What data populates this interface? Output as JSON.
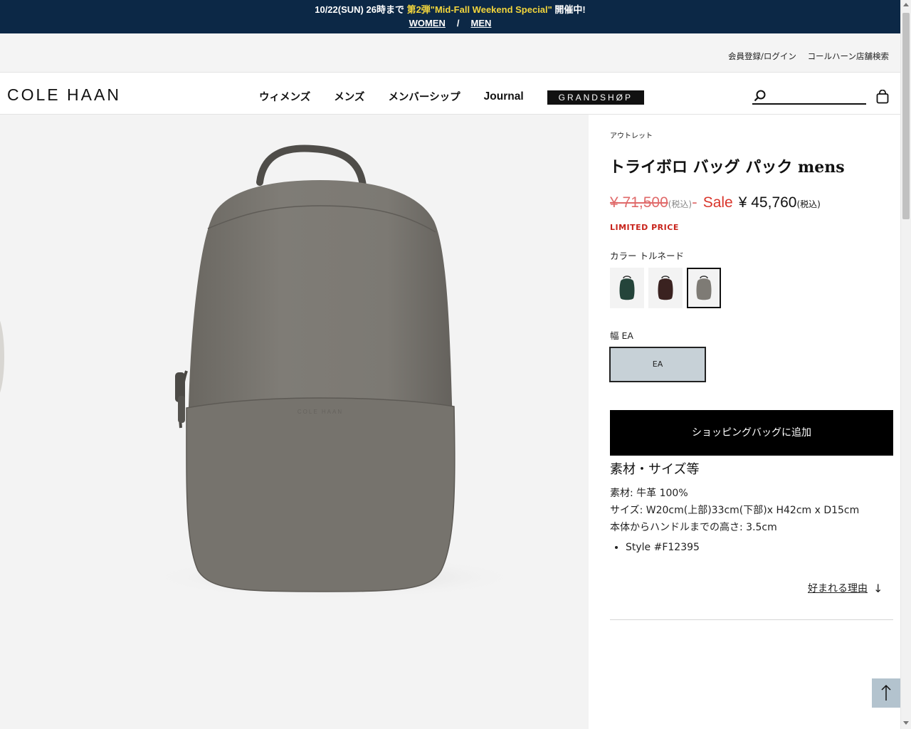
{
  "promo": {
    "prefix": "10/22(SUN) 26時まで ",
    "highlight": "第2弾\"Mid-Fall Weekend Special\"",
    "suffix": " 開催中!",
    "links": [
      "WOMEN",
      "MEN"
    ],
    "separator": "/"
  },
  "utility": {
    "register": "会員登録/ログイン",
    "store_search": "コールハーン店舗検索"
  },
  "header": {
    "logo": "COLE HAAN",
    "nav": [
      "ウィメンズ",
      "メンズ",
      "メンバーシップ",
      "Journal"
    ],
    "grandshop": "GRANDSHØP",
    "search_placeholder": ""
  },
  "product": {
    "breadcrumb": "アウトレット",
    "title": "トライボロ バッグ パック mens",
    "original_price": "¥ 71,500",
    "tax_note": "(税込)",
    "dash": "-",
    "sale_label": "Sale",
    "sale_price": "¥ 45,760",
    "limited": "LIMITED PRICE",
    "color_label": "カラー トルネード",
    "colors": [
      {
        "name": "green",
        "body": "#24443a",
        "active": false
      },
      {
        "name": "burgundy",
        "body": "#3a2220",
        "active": false
      },
      {
        "name": "tornado",
        "body": "#7e7b75",
        "active": true
      }
    ],
    "width_label": "幅 EA",
    "width_option": "EA",
    "add_to_bag": "ショッピングバッグに追加",
    "spec_title": "素材・サイズ等",
    "spec_lines": [
      "素材: 牛革 100%",
      "サイズ: W20cm(上部)33cm(下部)x H42cm x D15cm",
      "本体からハンドルまでの高さ: 3.5cm"
    ],
    "spec_bullets": [
      "Style #F12395"
    ],
    "reason": "好まれる理由",
    "reason_arrow": "↓",
    "image_brand": "COLE HAAN"
  },
  "colors": {
    "promo_bg": "#0c2846",
    "promo_highlight": "#f2d53c",
    "sale_red": "#d9352b",
    "width_selected": "#c7d1d7",
    "to_top_bg": "#b3c3ce"
  }
}
